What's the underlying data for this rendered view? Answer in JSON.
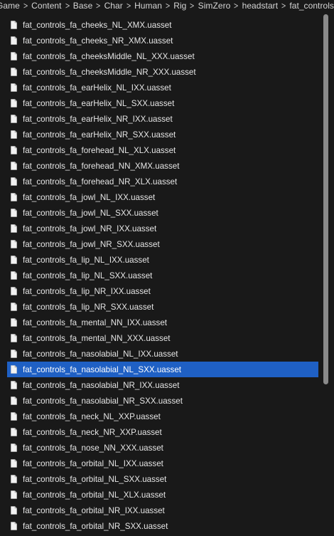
{
  "breadcrumb": {
    "items": [
      "Game",
      "Content",
      "Base",
      "Char",
      "Human",
      "Rig",
      "SimZero",
      "headstart",
      "fat_controls"
    ],
    "separator": ">"
  },
  "files": [
    "fat_controls_fa_cheeks_NL_XMX.uasset",
    "fat_controls_fa_cheeks_NR_XMX.uasset",
    "fat_controls_fa_cheeksMiddle_NL_XXX.uasset",
    "fat_controls_fa_cheeksMiddle_NR_XXX.uasset",
    "fat_controls_fa_earHelix_NL_IXX.uasset",
    "fat_controls_fa_earHelix_NL_SXX.uasset",
    "fat_controls_fa_earHelix_NR_IXX.uasset",
    "fat_controls_fa_earHelix_NR_SXX.uasset",
    "fat_controls_fa_forehead_NL_XLX.uasset",
    "fat_controls_fa_forehead_NN_XMX.uasset",
    "fat_controls_fa_forehead_NR_XLX.uasset",
    "fat_controls_fa_jowl_NL_IXX.uasset",
    "fat_controls_fa_jowl_NL_SXX.uasset",
    "fat_controls_fa_jowl_NR_IXX.uasset",
    "fat_controls_fa_jowl_NR_SXX.uasset",
    "fat_controls_fa_lip_NL_IXX.uasset",
    "fat_controls_fa_lip_NL_SXX.uasset",
    "fat_controls_fa_lip_NR_IXX.uasset",
    "fat_controls_fa_lip_NR_SXX.uasset",
    "fat_controls_fa_mental_NN_IXX.uasset",
    "fat_controls_fa_mental_NN_XXX.uasset",
    "fat_controls_fa_nasolabial_NL_IXX.uasset",
    "fat_controls_fa_nasolabial_NL_SXX.uasset",
    "fat_controls_fa_nasolabial_NR_IXX.uasset",
    "fat_controls_fa_nasolabial_NR_SXX.uasset",
    "fat_controls_fa_neck_NL_XXP.uasset",
    "fat_controls_fa_neck_NR_XXP.uasset",
    "fat_controls_fa_nose_NN_XXX.uasset",
    "fat_controls_fa_orbital_NL_IXX.uasset",
    "fat_controls_fa_orbital_NL_SXX.uasset",
    "fat_controls_fa_orbital_NL_XLX.uasset",
    "fat_controls_fa_orbital_NR_IXX.uasset",
    "fat_controls_fa_orbital_NR_SXX.uasset"
  ],
  "selected_file": "fat_controls_fa_nasolabial_NL_SXX.uasset",
  "file_icon": "document-icon",
  "colors": {
    "background": "#191919",
    "selection": "#1f60c4",
    "text": "#e6e6e6",
    "scrollbar_thumb": "#8a8a8a"
  }
}
